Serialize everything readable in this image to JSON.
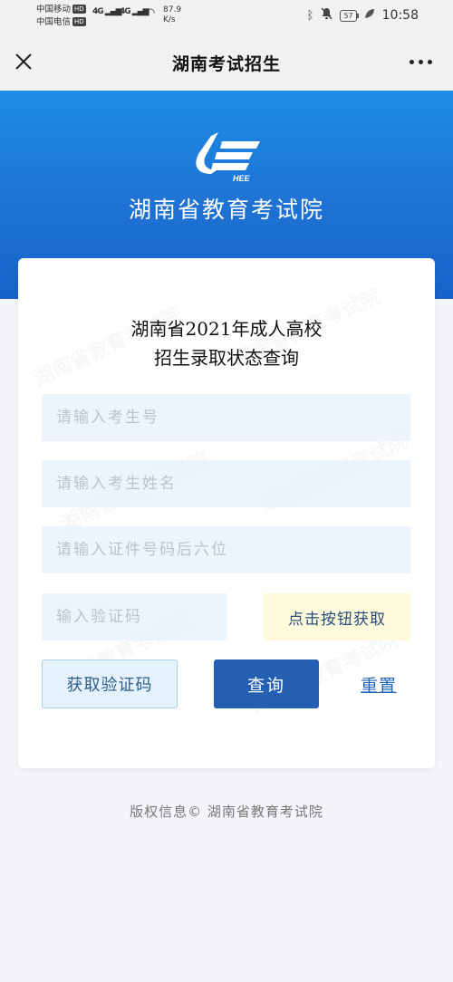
{
  "status_bar": {
    "carrier1": "中国移动",
    "carrier2": "中国电信",
    "hd_badge": "HD",
    "network1": "4G",
    "network2": "4G",
    "speed_value": "87.9",
    "speed_unit": "K/s",
    "battery": "57",
    "time": "10:58",
    "icons": [
      "bluetooth-icon",
      "mute-bell-icon",
      "battery-icon",
      "leaf-icon"
    ]
  },
  "nav": {
    "title": "湖南考试招生",
    "close_icon": "close-icon",
    "more_icon": "more-icon"
  },
  "banner": {
    "logo_text": "HEE",
    "title": "湖南省教育考试院"
  },
  "form": {
    "title_line1": "湖南省2021年成人高校",
    "title_line2": "招生录取状态查询",
    "exam_no_placeholder": "请输入考生号",
    "name_placeholder": "请输入考生姓名",
    "id_placeholder": "请输入证件号码后六位",
    "captcha_placeholder": "输入验证码",
    "captcha_button": "点击按钮获取",
    "sms_button": "获取验证码",
    "query_button": "查询",
    "reset_link": "重置",
    "watermark_text": "湖南省教育考试院"
  },
  "footer": {
    "copyright": "版权信息©  湖南省教育考试院"
  },
  "colors": {
    "brand_blue": "#1f72d4",
    "button_blue": "#245fb2",
    "captcha_bg": "#fdfbdc"
  }
}
